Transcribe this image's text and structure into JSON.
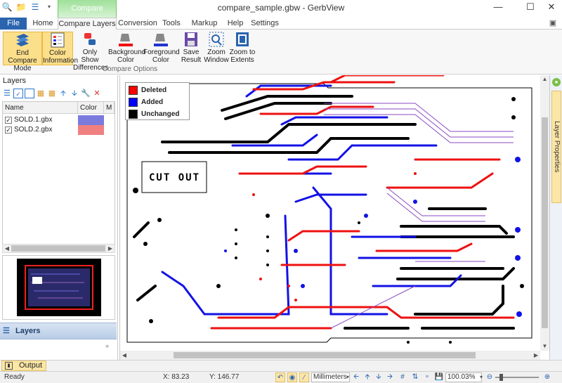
{
  "window": {
    "title": "compare_sample.gbw - GerbView",
    "minimize": "—",
    "maximize": "☐",
    "close": "✕"
  },
  "context_group": "Compare",
  "tabs": [
    "File",
    "Home",
    "Compare Layers",
    "Conversion",
    "Tools",
    "Markup",
    "Help",
    "Settings"
  ],
  "active_tab": "Compare Layers",
  "ribbon": {
    "buttons": [
      {
        "label": "End Compare Mode",
        "active": true
      },
      {
        "label": "Color Information",
        "active": true
      },
      {
        "label": "Only Show Differences",
        "active": false
      },
      {
        "label": "Background Color",
        "active": false
      },
      {
        "label": "Foreground Color",
        "active": false
      },
      {
        "label": "Save Result",
        "active": false
      },
      {
        "label": "Zoom Window",
        "active": false
      },
      {
        "label": "Zoom to Extents",
        "active": false
      }
    ],
    "group_label": "Compare Options"
  },
  "layers_panel": {
    "title": "Layers",
    "columns": [
      "Name",
      "Color",
      "M"
    ],
    "rows": [
      {
        "name": "SOLD.1.gbx",
        "checked": true,
        "color": "#7b7bde"
      },
      {
        "name": "SOLD.2.gbx",
        "checked": true,
        "color": "#f08080"
      }
    ],
    "tab_label": "Layers"
  },
  "legend": [
    {
      "label": "Deleted",
      "color": "#ff0000"
    },
    {
      "label": "Added",
      "color": "#0000ff"
    },
    {
      "label": "Unchanged",
      "color": "#000000"
    }
  ],
  "canvas": {
    "cutout_label": "CUT OUT"
  },
  "right_panel": {
    "label": "Layer Properties"
  },
  "output_tab": "Output",
  "status": {
    "ready": "Ready",
    "x": "X: 83.23",
    "y": "Y: 146.77",
    "units": "Millimeters",
    "zoom": "100.03%"
  }
}
